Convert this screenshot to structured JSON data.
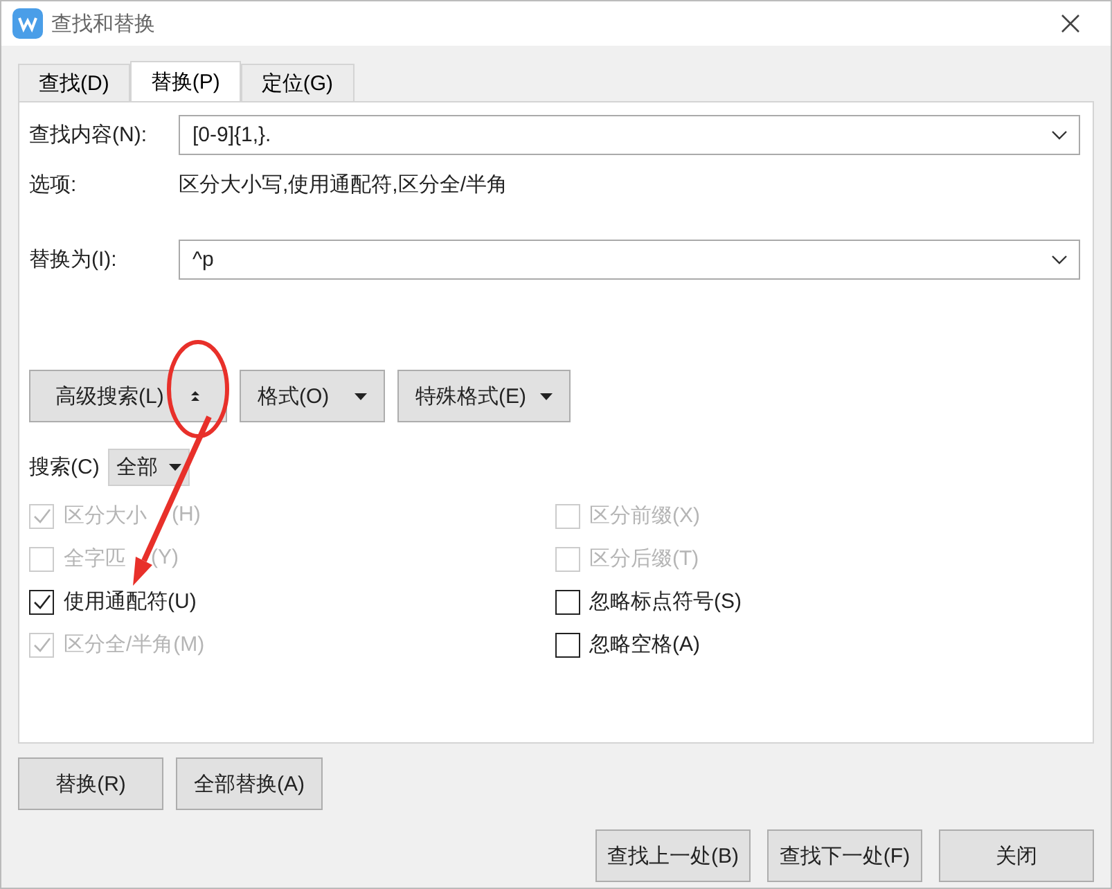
{
  "window": {
    "title": "查找和替换"
  },
  "tabs": [
    {
      "label": "查找(D)",
      "selected": false
    },
    {
      "label": "替换(P)",
      "selected": true
    },
    {
      "label": "定位(G)",
      "selected": false
    }
  ],
  "find": {
    "label": "查找内容(N):",
    "value": "[0-9]{1,}."
  },
  "options": {
    "label": "选项:",
    "value": "区分大小写,使用通配符,区分全/半角"
  },
  "replace": {
    "label": "替换为(I):",
    "value": "^p"
  },
  "tool_buttons": [
    {
      "label": "高级搜索(L)",
      "kind": "toggle"
    },
    {
      "label": "格式(O)",
      "kind": "menu"
    },
    {
      "label": "特殊格式(E)",
      "kind": "menu"
    }
  ],
  "search_scope": {
    "label": "搜索(C)",
    "value": "全部"
  },
  "options_left": [
    {
      "label": "区分大小",
      "label_tail": "(H)",
      "checked": true,
      "disabled": true
    },
    {
      "label": "全字匹",
      "label_tail": "(Y)",
      "checked": false,
      "disabled": true
    },
    {
      "label": "使用通配符(U)",
      "checked": true,
      "disabled": false
    },
    {
      "label": "区分全/半角(M)",
      "checked": true,
      "disabled": true
    }
  ],
  "options_right": [
    {
      "label": "区分前缀(X)",
      "checked": false,
      "disabled": true
    },
    {
      "label": "区分后缀(T)",
      "checked": false,
      "disabled": true
    },
    {
      "label": "忽略标点符号(S)",
      "checked": false,
      "disabled": false
    },
    {
      "label": "忽略空格(A)",
      "checked": false,
      "disabled": false
    }
  ],
  "replace_buttons": [
    "替换(R)",
    "全部替换(A)"
  ],
  "nav_buttons": [
    "查找上一处(B)",
    "查找下一处(F)",
    "关闭"
  ]
}
